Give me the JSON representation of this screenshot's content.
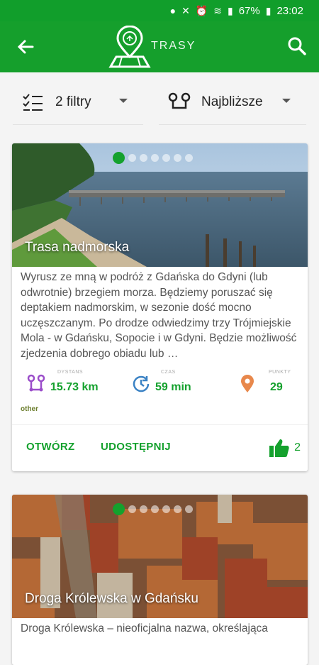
{
  "status_bar": {
    "battery": "67%",
    "time": "23:02",
    "icons": [
      "location-icon",
      "mute-icon",
      "alarm-icon",
      "wifi-icon",
      "signal-icon",
      "battery-icon"
    ]
  },
  "app_bar": {
    "title": "TRASY"
  },
  "filters": {
    "filter_label": "2 filtry",
    "sort_label": "Najbliższe"
  },
  "routes": [
    {
      "title": "Trasa nadmorska",
      "description": "Wyrusz ze mną w podróż z Gdańska do Gdyni (lub odwrotnie) brzegiem morza. Będziemy poruszać się deptakiem nadmorskim, w sezonie dość mocno uczęszczanym. Po drodze odwiedzimy trzy Trójmiejskie Mola - w Gdańsku, Sopocie i w Gdyni. Będzie możliwość zjedzenia dobrego obiadu lub …",
      "distance_label": "DYSTANS",
      "distance": "15.73 km",
      "time_label": "CZAS",
      "time": "59 min",
      "points_label": "PUNKTY",
      "points": "29",
      "category": "other",
      "open_label": "OTWÓRZ",
      "share_label": "UDOSTĘPNIJ",
      "likes": "2"
    },
    {
      "title": "Droga Królewska w Gdańsku",
      "description": "Droga Królewska – nieoficjalna nazwa, określająca"
    }
  ],
  "colors": {
    "primary": "#159f2c",
    "accent_green": "#14a12d",
    "distance_icon": "#9b4dca",
    "time_icon": "#3b82c4",
    "points_icon": "#e8884c"
  }
}
